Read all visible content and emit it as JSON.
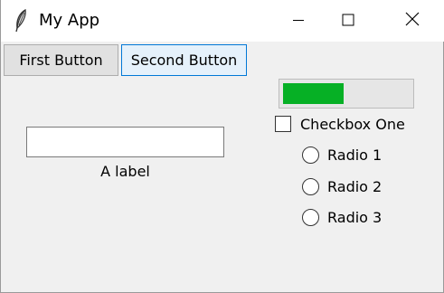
{
  "window": {
    "title": "My App",
    "icon": "feather-icon",
    "controls": [
      "minimize-icon",
      "maximize-icon",
      "close-icon"
    ]
  },
  "buttons": {
    "first_label": "First Button",
    "second_label": "Second Button"
  },
  "progress": {
    "value": 0.48,
    "color": "#06b025"
  },
  "entry": {
    "value": "",
    "placeholder": ""
  },
  "label_text": "A label",
  "checkbox": {
    "label": "Checkbox One",
    "checked": false
  },
  "radios": {
    "items": [
      {
        "label": "Radio 1",
        "selected": false
      },
      {
        "label": "Radio 2",
        "selected": false
      },
      {
        "label": "Radio 3",
        "selected": false
      }
    ]
  },
  "colors": {
    "focus_border": "#0078d7",
    "window_bg": "#f0f0f0"
  }
}
